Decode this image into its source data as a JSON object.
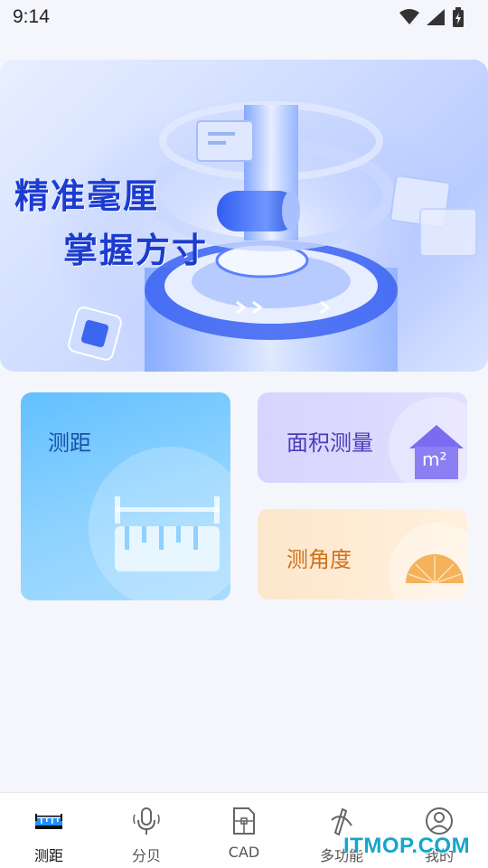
{
  "status_bar": {
    "time": "9:14",
    "icons": [
      "wifi-icon",
      "signal-icon",
      "battery-icon"
    ]
  },
  "banner": {
    "headline": "精准毫厘",
    "subline": "掌握方寸"
  },
  "cards": {
    "distance": {
      "label": "测距",
      "icon": "ruler-icon"
    },
    "area": {
      "label": "面积测量",
      "icon": "house-m2-icon",
      "icon_text": "m²"
    },
    "angle": {
      "label": "测角度",
      "icon": "protractor-icon"
    }
  },
  "nav": {
    "items": [
      {
        "label": "测距",
        "icon": "ruler-icon",
        "active": true
      },
      {
        "label": "分贝",
        "icon": "microphone-icon",
        "active": false
      },
      {
        "label": "CAD",
        "icon": "cad-icon",
        "active": false
      },
      {
        "label": "多功能",
        "icon": "multi-tool-icon",
        "active": false
      },
      {
        "label": "我的",
        "icon": "profile-icon",
        "active": false
      }
    ]
  },
  "watermark": "ITMOP.COM",
  "colors": {
    "accent_blue": "#1c3ccf",
    "distance_card": "#62c0ff",
    "area_card": "#d7d4ff",
    "angle_card": "#fde7cc"
  }
}
